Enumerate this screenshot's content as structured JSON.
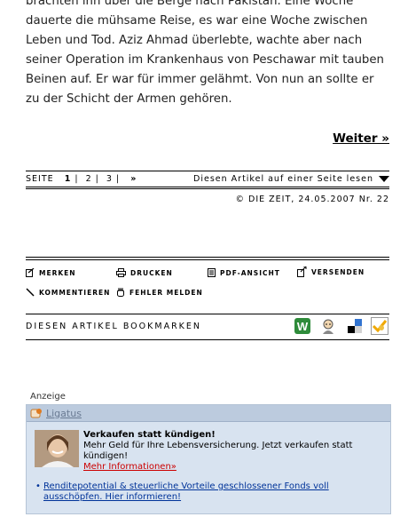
{
  "article": {
    "paragraph": "brachten ihn über die Berge nach Pakistan. Eine Woche dauerte die mühsame Reise, es war eine Woche zwischen Leben und Tod. Aziz Ahmad überlebte, wachte aber nach seiner Operation im Krankenhaus von Peschawar mit tauben Beinen auf. Er war für immer gelähmt. Von nun an sollte er zu der Schicht der Armen gehören.",
    "next_link": "Weiter »"
  },
  "pager": {
    "label": "SEITE",
    "pages": [
      "1",
      "2",
      "3"
    ],
    "current": "1",
    "next": "»",
    "single_page": "Diesen Artikel auf einer Seite lesen"
  },
  "copyright": "© DIE ZEIT, 24.05.2007 Nr. 22",
  "tools": {
    "merken": "MERKEN",
    "drucken": "DRUCKEN",
    "pdf": "PDF-ANSICHT",
    "versenden": "VERSENDEN",
    "kommentieren": "KOMMENTIEREN",
    "fehler": "FEHLER MELDEN"
  },
  "bookmarks": {
    "label": "DIESEN ARTIKEL BOOKMARKEN",
    "services": [
      "webnews-icon",
      "mister-wong-icon",
      "delicious-icon",
      "yigg-icon"
    ]
  },
  "ad": {
    "label": "Anzeige",
    "provider": "Ligatus",
    "title": "Verkaufen statt kündigen!",
    "text": "Mehr Geld für Ihre Lebensversicherung. Jetzt verkaufen statt kündigen!",
    "more": "Mehr Informationen»",
    "bullet": "Renditepotential & steuerliche Vorteile geschlossener Fonds voll ausschöpfen. Hier informieren!"
  },
  "colors": {
    "ad_background": "#d8e3f0",
    "ad_header": "#bccbde",
    "link_red": "#cc0000",
    "link_blue": "#003399"
  }
}
